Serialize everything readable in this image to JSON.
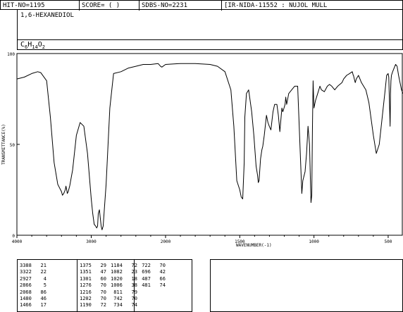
{
  "header": {
    "hit_no": "HIT-NO=1195",
    "score": "SCORE=  (  )",
    "sdbs_no": "SDBS-NO=2231",
    "ir_id": "IR-NIDA-11552 : NUJOL MULL"
  },
  "compound": {
    "name": "1,6-HEXANEDIOL",
    "formula_parts": [
      "C",
      "6",
      "H",
      "14",
      "O",
      "2"
    ]
  },
  "chart_data": {
    "type": "line",
    "xlabel": "WAVENUMBER(-1)",
    "ylabel": "TRANSMITTANCE(%)",
    "xlim": [
      4000,
      400
    ],
    "ylim": [
      0,
      100
    ],
    "x_ticks": [
      4000,
      3000,
      2000,
      1500,
      1000,
      500
    ],
    "x_tick_labels": [
      "4000",
      "3000",
      "2000",
      "1500",
      "1000",
      "500"
    ],
    "y_ticks": [
      0,
      50,
      100
    ],
    "y_tick_labels": [
      "0",
      "50",
      "100"
    ],
    "series": [
      {
        "x": [
          4000,
          3900,
          3800,
          3720,
          3680,
          3600,
          3550,
          3500,
          3450,
          3400,
          3388,
          3370,
          3350,
          3340,
          3330,
          3322,
          3310,
          3290,
          3250,
          3200,
          3150,
          3100,
          3050,
          3000,
          2980,
          2960,
          2940,
          2927,
          2915,
          2905,
          2890,
          2880,
          2866,
          2855,
          2840,
          2800,
          2750,
          2700,
          2600,
          2500,
          2400,
          2300,
          2200,
          2100,
          2068,
          2050,
          2000,
          1900,
          1800,
          1700,
          1650,
          1600,
          1560,
          1540,
          1520,
          1500,
          1490,
          1480,
          1470,
          1466,
          1455,
          1440,
          1420,
          1405,
          1390,
          1380,
          1375,
          1370,
          1360,
          1351,
          1345,
          1335,
          1320,
          1310,
          1301,
          1290,
          1276,
          1265,
          1250,
          1240,
          1230,
          1216,
          1210,
          1202,
          1195,
          1190,
          1187,
          1184,
          1170,
          1150,
          1130,
          1110,
          1090,
          1082,
          1075,
          1060,
          1050,
          1040,
          1030,
          1020,
          1015,
          1010,
          1006,
          1000,
          990,
          975,
          960,
          950,
          930,
          910,
          895,
          880,
          860,
          840,
          811,
          800,
          780,
          760,
          742,
          735,
          734,
          728,
          722,
          715,
          700,
          690,
          680,
          650,
          630,
          600,
          580,
          560,
          540,
          520,
          510,
          500,
          496,
          490,
          487,
          484,
          481,
          478,
          470,
          460,
          450,
          440,
          430,
          420,
          410,
          400
        ],
        "y": [
          86,
          87,
          89,
          90,
          89.5,
          85,
          65,
          40,
          28,
          24,
          22,
          23,
          25,
          27,
          25,
          23,
          24,
          27,
          36,
          55,
          62,
          60,
          45,
          20,
          12,
          6,
          5,
          4,
          5,
          12,
          14,
          10,
          5,
          3,
          5,
          28,
          70,
          89,
          90,
          92,
          93,
          94,
          94,
          94.5,
          93,
          92.5,
          94,
          94.5,
          94.5,
          94,
          93,
          90,
          80,
          60,
          30,
          25,
          21,
          20,
          40,
          65,
          78,
          80,
          68,
          55,
          38,
          33,
          29,
          30,
          42,
          47,
          49,
          55,
          66,
          62,
          60,
          58,
          68,
          72,
          72,
          66,
          57,
          70,
          68,
          70,
          72,
          76,
          74,
          72,
          78,
          80,
          82,
          82,
          40,
          23,
          30,
          35,
          45,
          60,
          50,
          18,
          22,
          60,
          85,
          70,
          74,
          78,
          82,
          80,
          79,
          82,
          83,
          82,
          80,
          82,
          84,
          86,
          88,
          89,
          90,
          88,
          88,
          86,
          84,
          86,
          88,
          86,
          84,
          80,
          73,
          55,
          45,
          50,
          65,
          80,
          88,
          89,
          87,
          70,
          60,
          78,
          85,
          88,
          90,
          92,
          94,
          93,
          88,
          84,
          80,
          78
        ]
      }
    ]
  },
  "peaks": [
    [
      [
        "3388",
        "21"
      ],
      [
        "3322",
        "22"
      ],
      [
        "2927",
        "4"
      ],
      [
        "2866",
        "5"
      ],
      [
        "2068",
        "86"
      ],
      [
        "1480",
        "46"
      ],
      [
        "1466",
        "17"
      ]
    ],
    [
      [
        "1375",
        "29"
      ],
      [
        "1351",
        "47"
      ],
      [
        "1301",
        "60"
      ],
      [
        "1276",
        "70"
      ],
      [
        "1216",
        "70"
      ],
      [
        "1202",
        "70"
      ],
      [
        "1190",
        "72"
      ]
    ],
    [
      [
        "1184",
        "72"
      ],
      [
        "1082",
        "23"
      ],
      [
        "1020",
        "18"
      ],
      [
        "1006",
        "38"
      ],
      [
        "811",
        "79"
      ],
      [
        "742",
        "70"
      ],
      [
        "734",
        "74"
      ]
    ],
    [
      [
        "722",
        "70"
      ],
      [
        "696",
        "42"
      ],
      [
        "487",
        "66"
      ],
      [
        "481",
        "74"
      ]
    ]
  ]
}
